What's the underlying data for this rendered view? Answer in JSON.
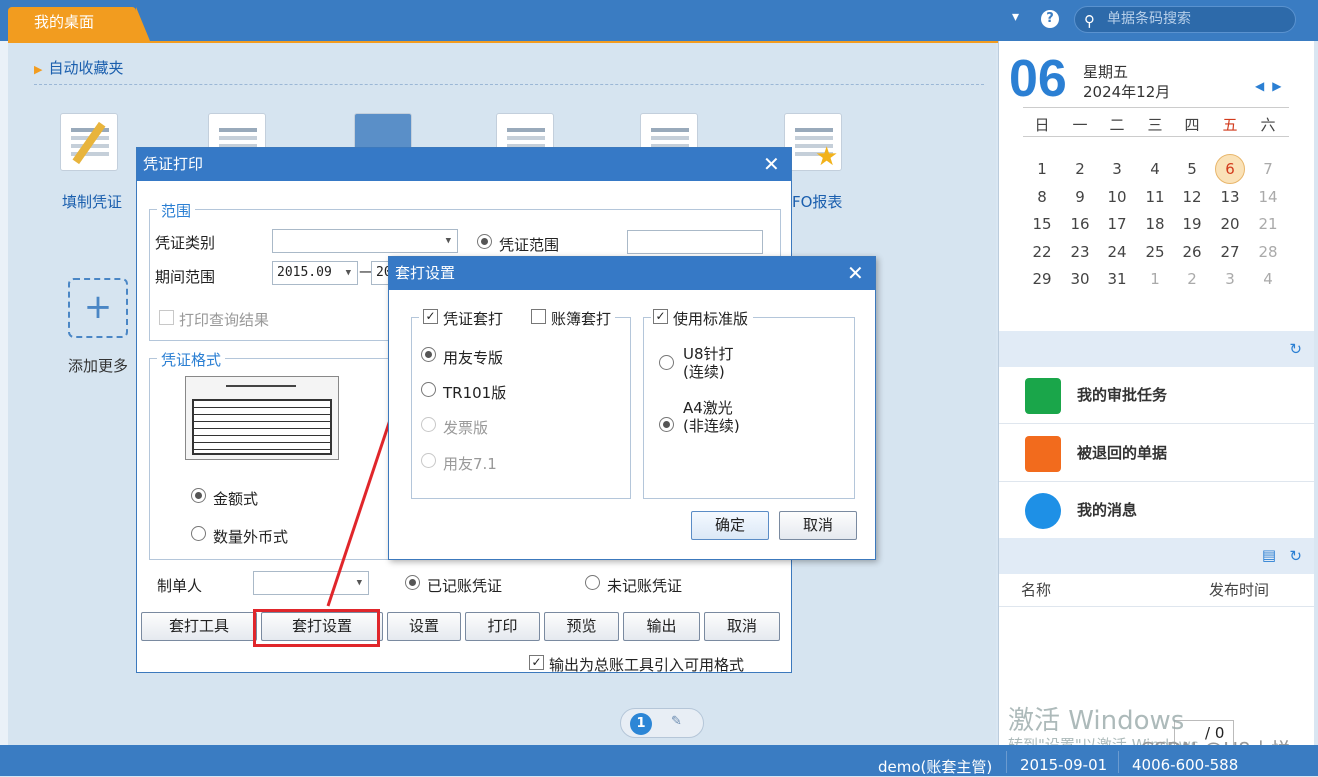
{
  "topbar": {
    "tab_label": "我的桌面",
    "search_placeholder": "单据条码搜索"
  },
  "desktop": {
    "favorites_label": "自动收藏夹",
    "apps": [
      {
        "label": "填制凭证"
      },
      {
        "label": "FO报表"
      }
    ],
    "add_more_label": "添加更多",
    "page_current": "1"
  },
  "calendar": {
    "day": "06",
    "weekday": "星期五",
    "year_month": "2024年12月",
    "headers": [
      "日",
      "一",
      "二",
      "三",
      "四",
      "五",
      "六"
    ],
    "rows": [
      [
        "1",
        "2",
        "3",
        "4",
        "5",
        "6",
        "7"
      ],
      [
        "8",
        "9",
        "10",
        "11",
        "12",
        "13",
        "14"
      ],
      [
        "15",
        "16",
        "17",
        "18",
        "19",
        "20",
        "21"
      ],
      [
        "22",
        "23",
        "24",
        "25",
        "26",
        "27",
        "28"
      ],
      [
        "29",
        "30",
        "31",
        "1",
        "2",
        "3",
        "4"
      ]
    ]
  },
  "tasks": [
    {
      "label": "我的审批任务",
      "color": "#1aa64a"
    },
    {
      "label": "被退回的单据",
      "color": "#f26b1d"
    },
    {
      "label": "我的消息",
      "color": "#1e90e6"
    }
  ],
  "news": {
    "col_name": "名称",
    "col_time": "发布时间",
    "page_total": "/ 0"
  },
  "watermark": {
    "line1": "激活 Windows",
    "line2": "转到\"设置\"以激活 Windows。",
    "csdn": "CSDN @U8小悦"
  },
  "statusbar": {
    "user": "demo(账套主管)",
    "date": "2015-09-01",
    "phone": "4006-600-588"
  },
  "voucher_print": {
    "title": "凭证打印",
    "range_group": "范围",
    "voucher_type_label": "凭证类别",
    "period_label": "期间范围",
    "period_from": "2015.09",
    "period_to_partial": "20",
    "voucher_range_label": "凭证范围",
    "print_query_label": "打印查询结果",
    "format_group": "凭证格式",
    "format_amount": "金额式",
    "format_qty": "数量外币式",
    "maker_label": "制单人",
    "posted_label": "已记账凭证",
    "unposted_label": "未记账凭证",
    "buttons": [
      "套打工具",
      "套打设置",
      "设置",
      "打印",
      "预览",
      "输出",
      "取消"
    ],
    "export_label": "输出为总账工具引入可用格式"
  },
  "overlay_settings": {
    "title": "套打设置",
    "voucher_overlay": "凭证套打",
    "ledger_overlay": "账簿套打",
    "opt_yonyou": "用友专版",
    "opt_tr101": "TR101版",
    "opt_invoice": "发票版",
    "opt_yonyou71": "用友7.1",
    "use_standard": "使用标准版",
    "u8_dot": "U8针打",
    "u8_dot_sub": "(连续)",
    "a4_laser": "A4激光",
    "a4_laser_sub": "(非连续)",
    "ok": "确定",
    "cancel": "取消"
  }
}
